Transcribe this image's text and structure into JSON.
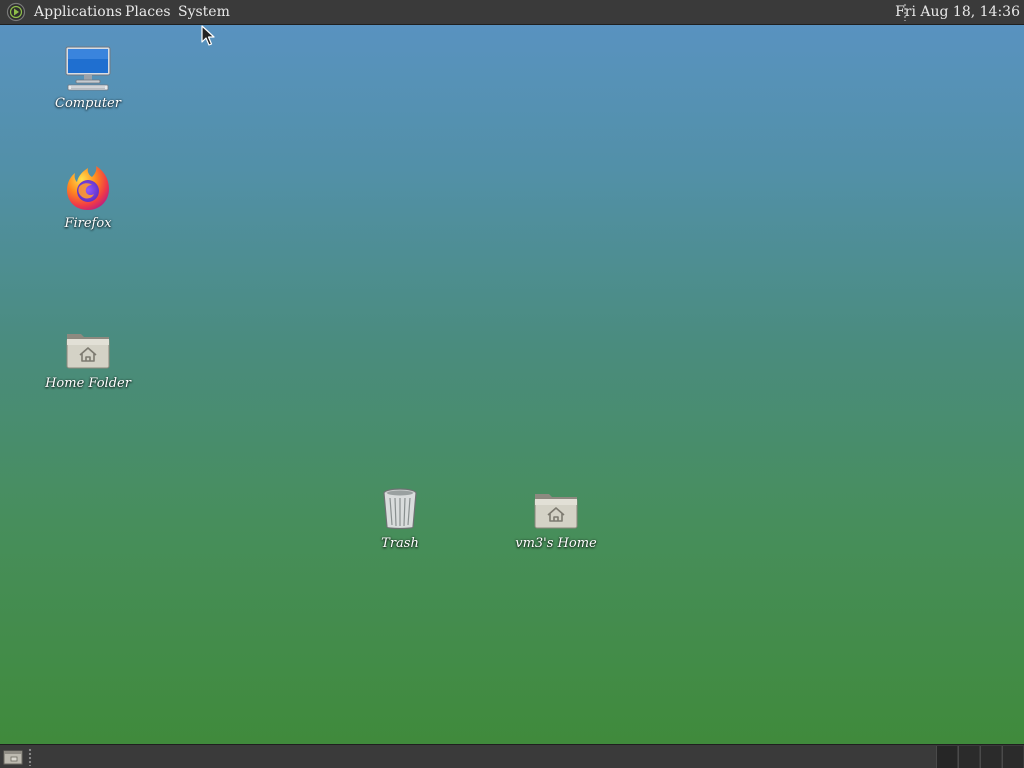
{
  "top_panel": {
    "menus": {
      "applications": "Applications",
      "places": "Places",
      "system": "System"
    },
    "clock": "Fri Aug 18, 14:36",
    "logo_icon": "mate-logo-icon"
  },
  "desktop": {
    "icons": {
      "computer": {
        "label": "Computer",
        "icon": "computer-icon"
      },
      "firefox": {
        "label": "Firefox",
        "icon": "firefox-icon"
      },
      "home_folder": {
        "label": "Home Folder",
        "icon": "home-folder-icon"
      },
      "trash": {
        "label": "Trash",
        "icon": "trash-icon"
      },
      "vm3_home": {
        "label": "vm3's Home",
        "icon": "home-folder-icon"
      }
    },
    "background_colors": {
      "top": "#5a93c4",
      "bottom": "#3f8a38"
    }
  },
  "bottom_panel": {
    "show_desktop_icon": "show-desktop-icon",
    "workspaces": 4
  },
  "colors": {
    "panel": "#3a3a3a",
    "panel_text": "#e8e8e8"
  }
}
